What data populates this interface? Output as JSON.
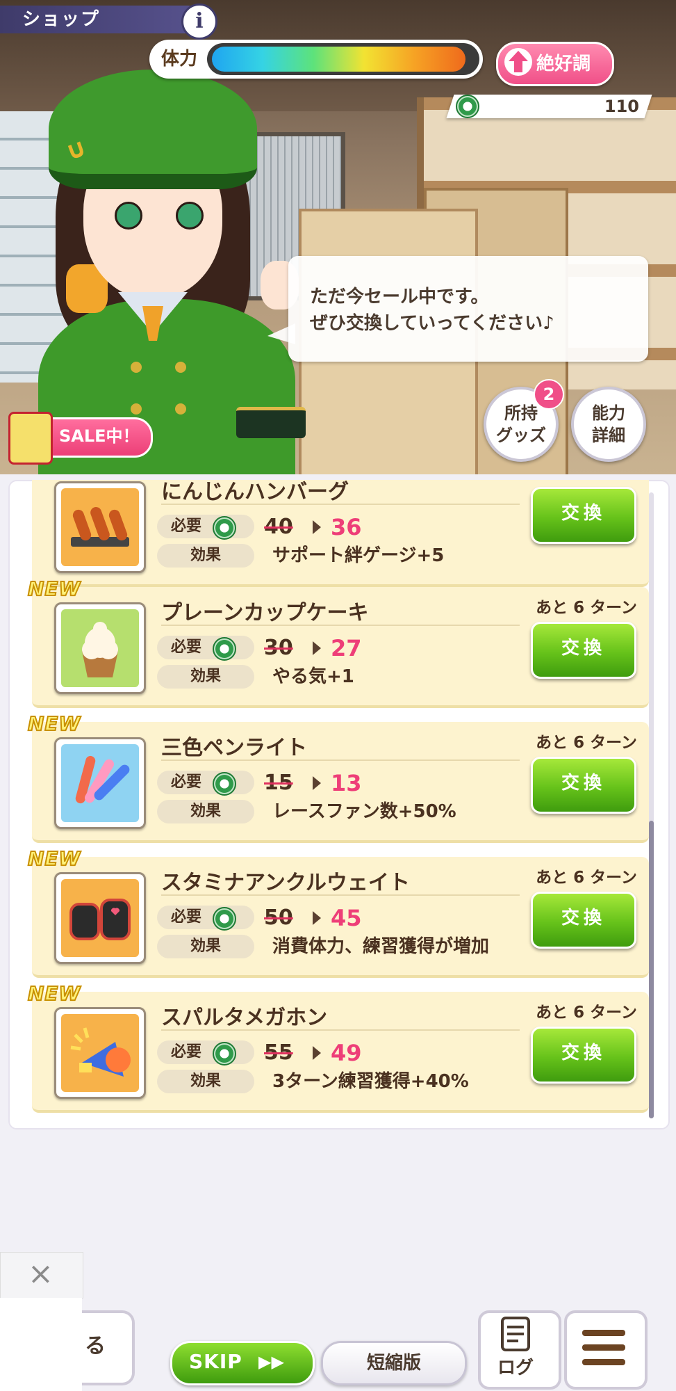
{
  "header": {
    "title": "ショップ",
    "info_icon": "i",
    "stamina_label": "体力",
    "stamina_fill": 0.96,
    "mood_label": "絶好調",
    "coins": "110"
  },
  "dialog": {
    "line1": "ただ今セール中です。",
    "line2": "ぜひ交換していってください♪"
  },
  "side_buttons": {
    "goods_line1": "所持",
    "goods_line2": "グッズ",
    "goods_badge": "2",
    "ability_line1": "能力",
    "ability_line2": "詳細"
  },
  "sale_badge": "SALE中！",
  "labels": {
    "required": "必要",
    "effect": "効果",
    "exchange": "交換",
    "new": "NEW"
  },
  "items": [
    {
      "name": "にんじんハンバーグ",
      "old_price": "40",
      "price": "36",
      "effect": "サポート絆ゲージ+5",
      "remain": "",
      "is_new": false
    },
    {
      "name": "プレーンカップケーキ",
      "old_price": "30",
      "price": "27",
      "effect": "やる気+1",
      "remain": "あと 6 ターン",
      "is_new": true
    },
    {
      "name": "三色ペンライト",
      "old_price": "15",
      "price": "13",
      "effect": "レースファン数+50%",
      "remain": "あと 6 ターン",
      "is_new": true
    },
    {
      "name": "スタミナアンクルウェイト",
      "old_price": "50",
      "price": "45",
      "effect": "消費体力、練習獲得が増加",
      "remain": "あと 6 ターン",
      "is_new": true
    },
    {
      "name": "スパルタメガホン",
      "old_price": "55",
      "price": "49",
      "effect": "3ターン練習獲得+40%",
      "remain": "あと 6 ターン",
      "is_new": true
    }
  ],
  "bottom": {
    "back_label": "る",
    "skip_label": "SKIP",
    "skip_icon": "▶▶",
    "short_label": "短縮版",
    "log_label": "ログ",
    "ad_close": "×"
  },
  "colors": {
    "accent_pink": "#ee3e78",
    "button_green": "#66c21a",
    "card_bg": "#fdf3cf"
  }
}
